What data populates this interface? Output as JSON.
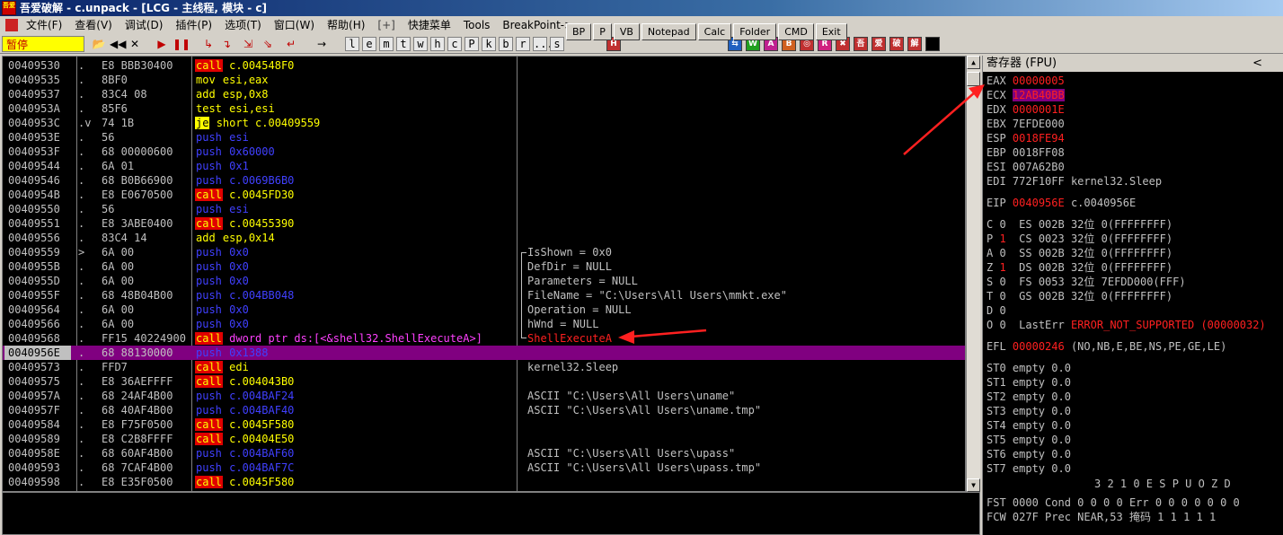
{
  "window": {
    "title": "吾爱破解 - c.unpack - [LCG - 主线程, 模块 - c]",
    "icon_label": "吾爱破解"
  },
  "menu": {
    "items": [
      "文件(F)",
      "查看(V)",
      "调试(D)",
      "插件(P)",
      "选项(T)",
      "窗口(W)",
      "帮助(H)",
      "[+]",
      "快捷菜单",
      "Tools",
      "BreakPoint->"
    ]
  },
  "plugin_buttons": [
    "BP",
    "P",
    "VB",
    "Notepad",
    "Calc",
    "Folder",
    "CMD",
    "Exit"
  ],
  "toolbar": {
    "status": "暂停",
    "letters": [
      "l",
      "e",
      "m",
      "t",
      "w",
      "h",
      "c",
      "P",
      "k",
      "b",
      "r",
      "...",
      "s"
    ]
  },
  "disasm": {
    "rows": [
      {
        "addr": "00409530",
        "mark": ".",
        "hex": "E8 BBB30400",
        "mn": "call",
        "kind": "call",
        "op": "c.004548F0",
        "cmt": ""
      },
      {
        "addr": "00409535",
        "mark": ".",
        "hex": "8BF0",
        "mn": "mov",
        "kind": "norm",
        "op": "esi,eax",
        "cmt": ""
      },
      {
        "addr": "00409537",
        "mark": ".",
        "hex": "83C4 08",
        "mn": "add",
        "kind": "norm",
        "op": "esp,0x8",
        "cmt": ""
      },
      {
        "addr": "0040953A",
        "mark": ".",
        "hex": "85F6",
        "mn": "test",
        "kind": "norm",
        "op": "esi,esi",
        "cmt": ""
      },
      {
        "addr": "0040953C",
        "mark": ".v",
        "hex": "74 1B",
        "mn": "je",
        "kind": "je",
        "op": "short c.00409559",
        "cmt": ""
      },
      {
        "addr": "0040953E",
        "mark": ".",
        "hex": "56",
        "mn": "push",
        "kind": "push",
        "op": "esi",
        "cmt": ""
      },
      {
        "addr": "0040953F",
        "mark": ".",
        "hex": "68 00000600",
        "mn": "push",
        "kind": "push",
        "op": "0x60000",
        "cmt": ""
      },
      {
        "addr": "00409544",
        "mark": ".",
        "hex": "6A 01",
        "mn": "push",
        "kind": "push",
        "op": "0x1",
        "cmt": ""
      },
      {
        "addr": "00409546",
        "mark": ".",
        "hex": "68 B0B66900",
        "mn": "push",
        "kind": "push",
        "op": "c.0069B6B0",
        "cmt": ""
      },
      {
        "addr": "0040954B",
        "mark": ".",
        "hex": "E8 E0670500",
        "mn": "call",
        "kind": "call",
        "op": "c.0045FD30",
        "cmt": ""
      },
      {
        "addr": "00409550",
        "mark": ".",
        "hex": "56",
        "mn": "push",
        "kind": "push",
        "op": "esi",
        "cmt": ""
      },
      {
        "addr": "00409551",
        "mark": ".",
        "hex": "E8 3ABE0400",
        "mn": "call",
        "kind": "call",
        "op": "c.00455390",
        "cmt": ""
      },
      {
        "addr": "00409556",
        "mark": ".",
        "hex": "83C4 14",
        "mn": "add",
        "kind": "norm",
        "op": "esp,0x14",
        "cmt": ""
      },
      {
        "addr": "00409559",
        "mark": ">",
        "hex": "6A 00",
        "mn": "push",
        "kind": "push",
        "op": "0x0",
        "cmt": "IsShown = 0x0"
      },
      {
        "addr": "0040955B",
        "mark": ".",
        "hex": "6A 00",
        "mn": "push",
        "kind": "push",
        "op": "0x0",
        "cmt": "DefDir = NULL"
      },
      {
        "addr": "0040955D",
        "mark": ".",
        "hex": "6A 00",
        "mn": "push",
        "kind": "push",
        "op": "0x0",
        "cmt": "Parameters = NULL"
      },
      {
        "addr": "0040955F",
        "mark": ".",
        "hex": "68 48B04B00",
        "mn": "push",
        "kind": "push",
        "op": "c.004BB048",
        "cmt": "FileName = \"C:\\Users\\All Users\\mmkt.exe\""
      },
      {
        "addr": "00409564",
        "mark": ".",
        "hex": "6A 00",
        "mn": "push",
        "kind": "push",
        "op": "0x0",
        "cmt": "Operation = NULL"
      },
      {
        "addr": "00409566",
        "mark": ".",
        "hex": "6A 00",
        "mn": "push",
        "kind": "push",
        "op": "0x0",
        "cmt": "hWnd = NULL"
      },
      {
        "addr": "00409568",
        "mark": ".",
        "hex": "FF15 40224900",
        "mn": "call",
        "kind": "callptr",
        "op": "dword ptr ds:[<&shell32.ShellExecuteA>]",
        "cmt": "ShellExecuteA",
        "cmt_red": true
      },
      {
        "addr": "0040956E",
        "mark": ".",
        "hex": "68 88130000",
        "mn": "push",
        "kind": "push",
        "op": "0x1388",
        "cmt": "",
        "selected": true
      },
      {
        "addr": "00409573",
        "mark": ".",
        "hex": "FFD7",
        "mn": "call",
        "kind": "call",
        "op": "edi",
        "cmt": "kernel32.Sleep"
      },
      {
        "addr": "00409575",
        "mark": ".",
        "hex": "E8 36AEFFFF",
        "mn": "call",
        "kind": "call",
        "op": "c.004043B0",
        "cmt": ""
      },
      {
        "addr": "0040957A",
        "mark": ".",
        "hex": "68 24AF4B00",
        "mn": "push",
        "kind": "push",
        "op": "c.004BAF24",
        "cmt": "ASCII \"C:\\Users\\All Users\\uname\""
      },
      {
        "addr": "0040957F",
        "mark": ".",
        "hex": "68 40AF4B00",
        "mn": "push",
        "kind": "push",
        "op": "c.004BAF40",
        "cmt": "ASCII \"C:\\Users\\All Users\\uname.tmp\""
      },
      {
        "addr": "00409584",
        "mark": ".",
        "hex": "E8 F75F0500",
        "mn": "call",
        "kind": "call",
        "op": "c.0045F580",
        "cmt": ""
      },
      {
        "addr": "00409589",
        "mark": ".",
        "hex": "E8 C2B8FFFF",
        "mn": "call",
        "kind": "call",
        "op": "c.00404E50",
        "cmt": ""
      },
      {
        "addr": "0040958E",
        "mark": ".",
        "hex": "68 60AF4B00",
        "mn": "push",
        "kind": "push",
        "op": "c.004BAF60",
        "cmt": "ASCII \"C:\\Users\\All Users\\upass\""
      },
      {
        "addr": "00409593",
        "mark": ".",
        "hex": "68 7CAF4B00",
        "mn": "push",
        "kind": "push",
        "op": "c.004BAF7C",
        "cmt": "ASCII \"C:\\Users\\All Users\\upass.tmp\""
      },
      {
        "addr": "00409598",
        "mark": ".",
        "hex": "E8 E35F0500",
        "mn": "call",
        "kind": "call",
        "op": "c.0045F580",
        "cmt": ""
      }
    ]
  },
  "registers": {
    "header": "寄存器 (FPU)",
    "collapse": "<",
    "gp": [
      {
        "name": "EAX",
        "value": "00000005",
        "extra": "",
        "style": "red"
      },
      {
        "name": "ECX",
        "value": "12AB40BB",
        "extra": "",
        "style": "hl"
      },
      {
        "name": "EDX",
        "value": "0000001E",
        "extra": "",
        "style": "red"
      },
      {
        "name": "EBX",
        "value": "7EFDE000",
        "extra": "",
        "style": ""
      },
      {
        "name": "ESP",
        "value": "0018FE94",
        "extra": "",
        "style": "red"
      },
      {
        "name": "EBP",
        "value": "0018FF08",
        "extra": "",
        "style": ""
      },
      {
        "name": "ESI",
        "value": "007A62B0",
        "extra": "",
        "style": ""
      },
      {
        "name": "EDI",
        "value": "772F10FF",
        "extra": "kernel32.Sleep",
        "style": ""
      }
    ],
    "eip": {
      "name": "EIP",
      "value": "0040956E",
      "extra": "c.0040956E"
    },
    "segs": [
      {
        "flag": "C",
        "fv": "0",
        "fred": false,
        "text": "ES 002B 32位 0(FFFFFFFF)"
      },
      {
        "flag": "P",
        "fv": "1",
        "fred": true,
        "text": "CS 0023 32位 0(FFFFFFFF)"
      },
      {
        "flag": "A",
        "fv": "0",
        "fred": false,
        "text": "SS 002B 32位 0(FFFFFFFF)"
      },
      {
        "flag": "Z",
        "fv": "1",
        "fred": true,
        "text": "DS 002B 32位 0(FFFFFFFF)"
      },
      {
        "flag": "S",
        "fv": "0",
        "fred": false,
        "text": "FS 0053 32位 7EFDD000(FFF)"
      },
      {
        "flag": "T",
        "fv": "0",
        "fred": false,
        "text": "GS 002B 32位 0(FFFFFFFF)"
      },
      {
        "flag": "D",
        "fv": "0",
        "fred": false,
        "text": ""
      },
      {
        "flag": "O",
        "fv": "0",
        "fred": false,
        "text": "LastErr"
      }
    ],
    "lasterr": "ERROR_NOT_SUPPORTED (00000032)",
    "efl": {
      "name": "EFL",
      "value": "00000246",
      "extra": "(NO,NB,E,BE,NS,PE,GE,LE)"
    },
    "st": [
      "ST0 empty 0.0",
      "ST1 empty 0.0",
      "ST2 empty 0.0",
      "ST3 empty 0.0",
      "ST4 empty 0.0",
      "ST5 empty 0.0",
      "ST6 empty 0.0",
      "ST7 empty 0.0"
    ],
    "fpu_hdr": "3 2 1 0      E S P U O Z D",
    "fst": "FST 0000  Cond 0 0 0 0  Err 0 0 0 0 0 0 0",
    "fcw": "FCW 027F  Prec NEAR,53  掩码    1 1 1 1 1"
  },
  "colors": {
    "call_bg": "#e00000",
    "push_fg": "#4040ff",
    "select_bg": "#800080",
    "annot": "#ff2020"
  }
}
